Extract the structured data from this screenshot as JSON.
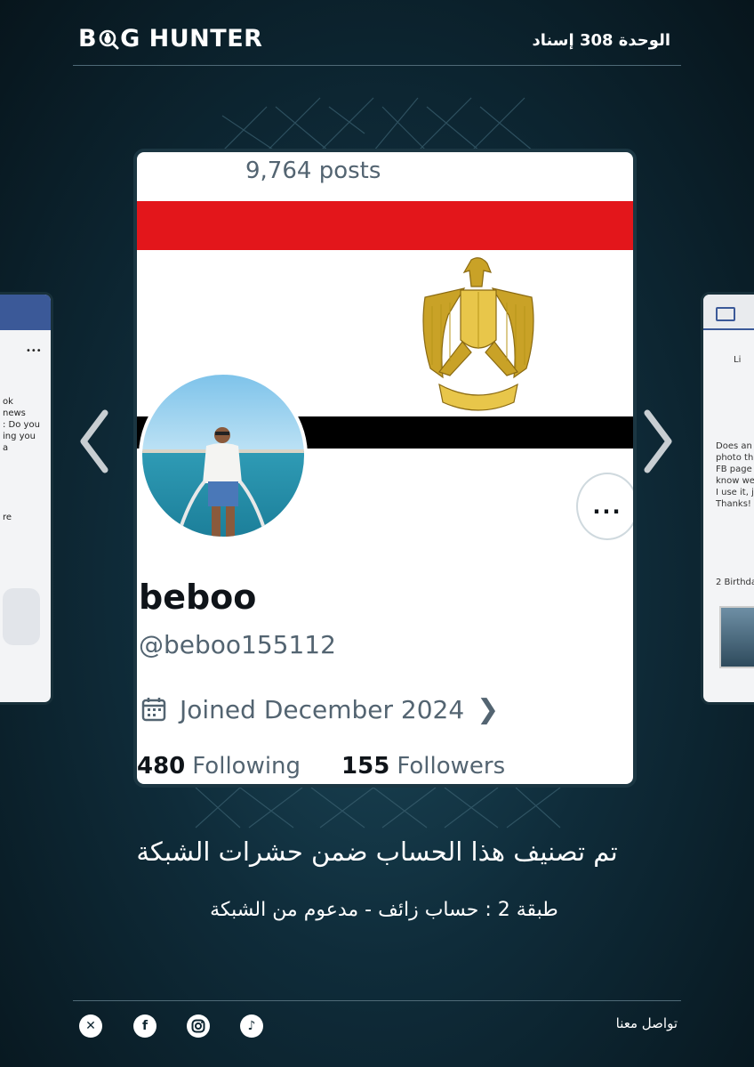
{
  "header": {
    "logo_text_prefix": "B",
    "logo_text_suffix": "G HUNTER",
    "unit_label": "الوحدة 308 إسناد"
  },
  "profile": {
    "posts_count": "9,764 posts",
    "display_name": "beboo",
    "handle": "@beboo155112",
    "joined": "Joined December 2024",
    "following_count": "480",
    "following_label": "Following",
    "followers_count": "155",
    "followers_label": "Followers",
    "more_label": "..."
  },
  "left_card": {
    "lines": [
      "ok",
      "news",
      ": Do you",
      "ing you",
      "a"
    ],
    "footer_text": "re"
  },
  "right_card": {
    "lines": [
      "Does an",
      "photo th",
      "FB page",
      "know we",
      "I use it, j",
      "Thanks!"
    ],
    "birthday_text": "2 Birthda",
    "like_text": "Li"
  },
  "caption": {
    "title": "تم تصنيف هذا الحساب ضمن حشرات الشبكة",
    "subtitle": "طبقة 2 : حساب زائف - مدعوم من الشبكة"
  },
  "footer": {
    "contact_label": "تواصل معنا",
    "social_icons": [
      "x-icon",
      "facebook-icon",
      "instagram-icon",
      "tiktok-icon"
    ]
  },
  "colors": {
    "flag_red": "#e3161b",
    "flag_black": "#000000",
    "eagle_gold": "#c9a227",
    "muted_text": "#536471"
  }
}
